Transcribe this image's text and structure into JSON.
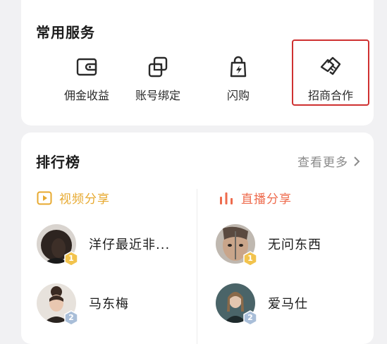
{
  "services": {
    "title": "常用服务",
    "items": [
      {
        "label": "佣金收益",
        "icon": "wallet-icon"
      },
      {
        "label": "账号绑定",
        "icon": "link-accounts-icon"
      },
      {
        "label": "闪购",
        "icon": "flash-bag-icon"
      },
      {
        "label": "招商合作",
        "icon": "handshake-icon",
        "highlighted": true
      }
    ],
    "highlight_color": "#cf3131"
  },
  "ranking": {
    "title": "排行榜",
    "more_label": "查看更多",
    "video": {
      "label": "视频分享",
      "color": "#e7a92f",
      "entries": [
        {
          "rank": "1",
          "name": "洋仔最近非..."
        },
        {
          "rank": "2",
          "name": "马东梅"
        }
      ]
    },
    "live": {
      "label": "直播分享",
      "color": "#ee6b4d",
      "entries": [
        {
          "rank": "1",
          "name": "无问东西"
        },
        {
          "rank": "2",
          "name": "爱马仕"
        }
      ]
    }
  }
}
